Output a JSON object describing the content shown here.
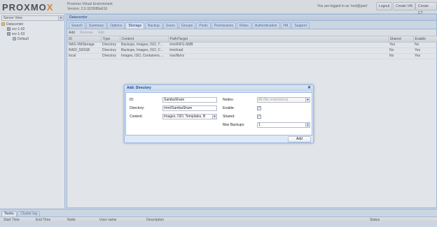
{
  "header": {
    "logo": "PROXMOX",
    "version_line1": "Proxmox Virtual Environment",
    "version_line2": "Version: 2.2-32/3089a616",
    "logged_in": "You are logged in as 'root@pam'",
    "buttons": [
      "Logout",
      "Create VM",
      "Create CT"
    ]
  },
  "left": {
    "view": "Server View",
    "tree": [
      {
        "label": "Datacenter",
        "icon": "folder-icon"
      },
      {
        "label": "srv-1-02",
        "icon": "server-icon"
      },
      {
        "label": "srv-1-03",
        "icon": "server-icon"
      },
      {
        "label": "Default",
        "icon": "disk-icon"
      }
    ]
  },
  "main": {
    "title": "Datacenter",
    "tabs": [
      "Search",
      "Summary",
      "Options",
      "Storage",
      "Backup",
      "Users",
      "Groups",
      "Pools",
      "Permissions",
      "Roles",
      "Authentication",
      "HA",
      "Support"
    ],
    "active_tab": "Storage",
    "toolbar": [
      "Add",
      "Remove",
      "Edit"
    ],
    "columns": [
      "ID",
      "Type",
      "Content",
      "Path/Target",
      "Shared",
      "Enable"
    ],
    "rows": [
      [
        "NAS-VMStorage",
        "Directory",
        "Backups, Images, ISO, T...",
        "/mnt/NFS-SMB",
        "Yes",
        "No"
      ],
      [
        "RAID_500GB",
        "Directory",
        "Backups, Images, ISO, C...",
        "/mnt/raid",
        "No",
        "Yes"
      ],
      [
        "local",
        "Directory",
        "Images, ISO, Containers, ...",
        "/var/lib/vz",
        "No",
        "Yes"
      ]
    ]
  },
  "dialog": {
    "title": "Add: Directory",
    "close_icon": "close-icon",
    "id_label": "ID:",
    "id_value": "SambaShare",
    "directory_label": "Directory:",
    "directory_value": "/mnt/SambaShare",
    "content_label": "Content:",
    "content_value": "Images, ISO, Templates, B",
    "nodes_label": "Nodes:",
    "nodes_value": "All (No restrictions)",
    "enable_label": "Enable:",
    "enable_checked": true,
    "shared_label": "Shared:",
    "shared_checked": true,
    "max_backups_label": "Max Backups:",
    "max_backups_value": "1",
    "add_button": "Add",
    "check_glyph": "✓"
  },
  "bottom": {
    "tabs": [
      "Tasks",
      "Cluster log"
    ],
    "columns": [
      "Start Time",
      "End Time",
      "Node",
      "User name",
      "Description",
      "Status"
    ]
  }
}
